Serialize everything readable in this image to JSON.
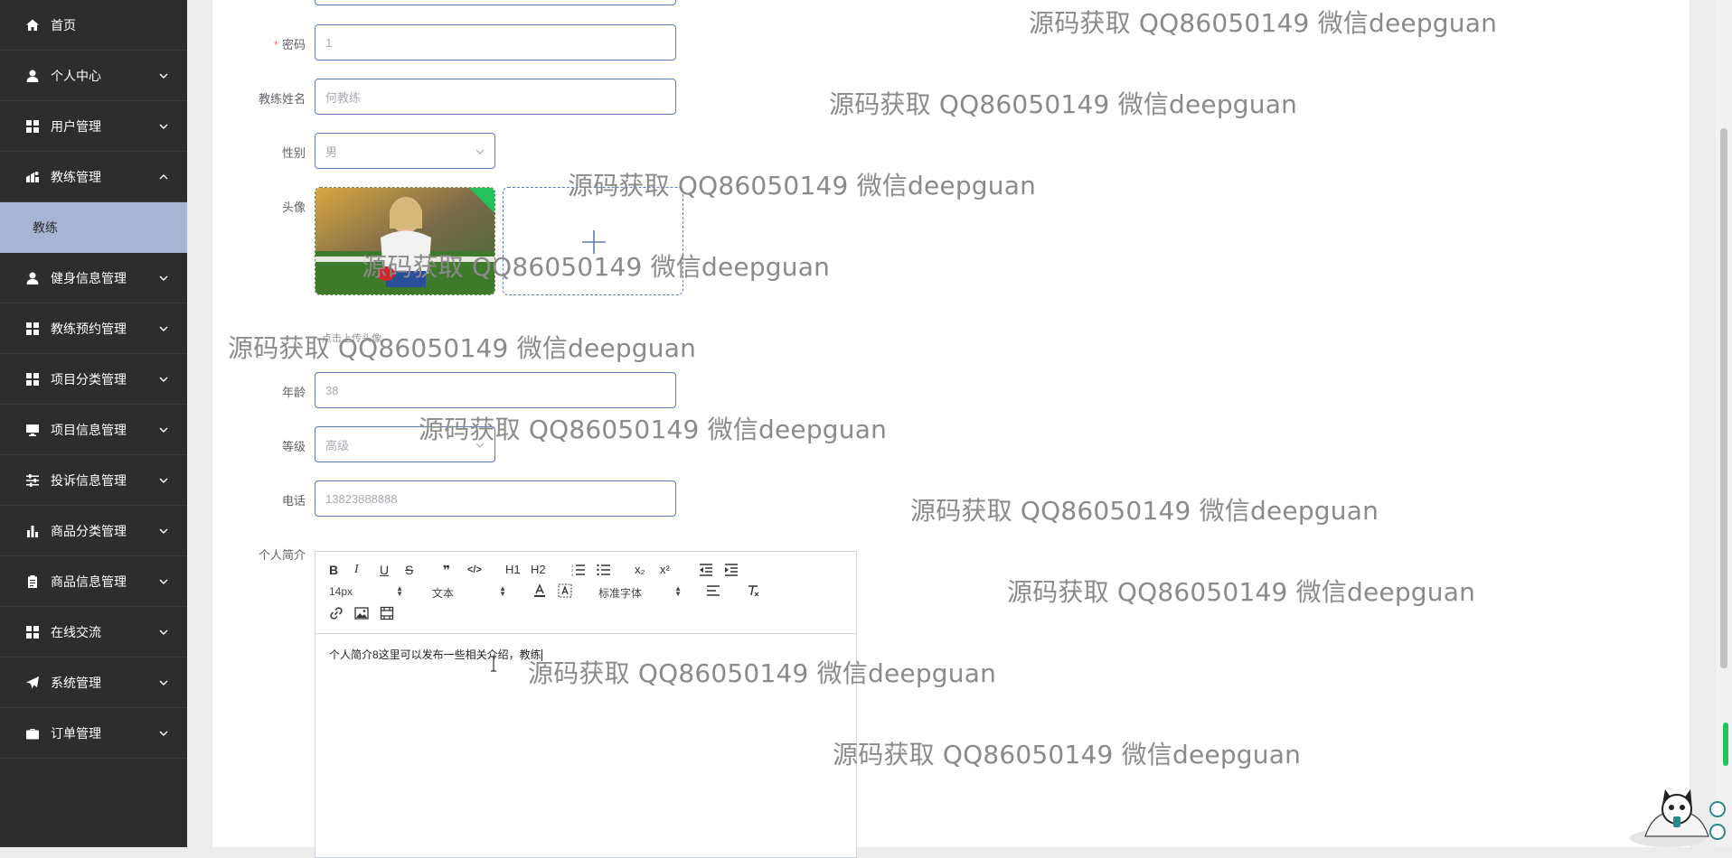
{
  "sidebar": {
    "items": [
      {
        "label": "首页",
        "icon": "home-icon"
      },
      {
        "label": "个人中心",
        "icon": "user-icon"
      },
      {
        "label": "用户管理",
        "icon": "grid-icon"
      },
      {
        "label": "教练管理",
        "icon": "coach-icon",
        "expanded": true
      },
      {
        "label": "健身信息管理",
        "icon": "user-icon"
      },
      {
        "label": "教练预约管理",
        "icon": "grid-icon"
      },
      {
        "label": "项目分类管理",
        "icon": "grid-icon"
      },
      {
        "label": "项目信息管理",
        "icon": "monitor-icon"
      },
      {
        "label": "投诉信息管理",
        "icon": "sliders-icon"
      },
      {
        "label": "商品分类管理",
        "icon": "bar-chart-icon"
      },
      {
        "label": "商品信息管理",
        "icon": "clipboard-icon"
      },
      {
        "label": "在线交流",
        "icon": "grid-icon"
      },
      {
        "label": "系统管理",
        "icon": "send-icon"
      },
      {
        "label": "订单管理",
        "icon": "briefcase-icon"
      }
    ],
    "sub_item": "教练"
  },
  "form": {
    "password": {
      "label": "密码",
      "value": "1"
    },
    "coach_name": {
      "label": "教练姓名",
      "placeholder": "何教练"
    },
    "gender": {
      "label": "性别",
      "value": "男"
    },
    "avatar": {
      "label": "头像",
      "tip": "点击上传头像"
    },
    "age": {
      "label": "年龄",
      "placeholder": "38"
    },
    "level": {
      "label": "等级",
      "value": "高级"
    },
    "phone": {
      "label": "电话",
      "placeholder": "13823888888"
    },
    "intro": {
      "label": "个人简介"
    }
  },
  "editor": {
    "buttons": [
      "B",
      "I",
      "U",
      "S",
      "❞",
      "</>",
      "H1",
      "H2",
      "ol",
      "ul",
      "x₂",
      "x²",
      "outdent",
      "indent"
    ],
    "font_size": "14px",
    "paragraph": "文本",
    "font_family": "标准字体",
    "content": "个人简介8这里可以发布一些相关介绍，教练"
  },
  "watermark": "源码获取 QQ86050149 微信deepguan",
  "colors": {
    "sidebar_bg": "#2d2d2e",
    "active_sub_bg": "#a6b5d2",
    "input_border": "#5d7bb8",
    "required": "#f56c6c"
  }
}
